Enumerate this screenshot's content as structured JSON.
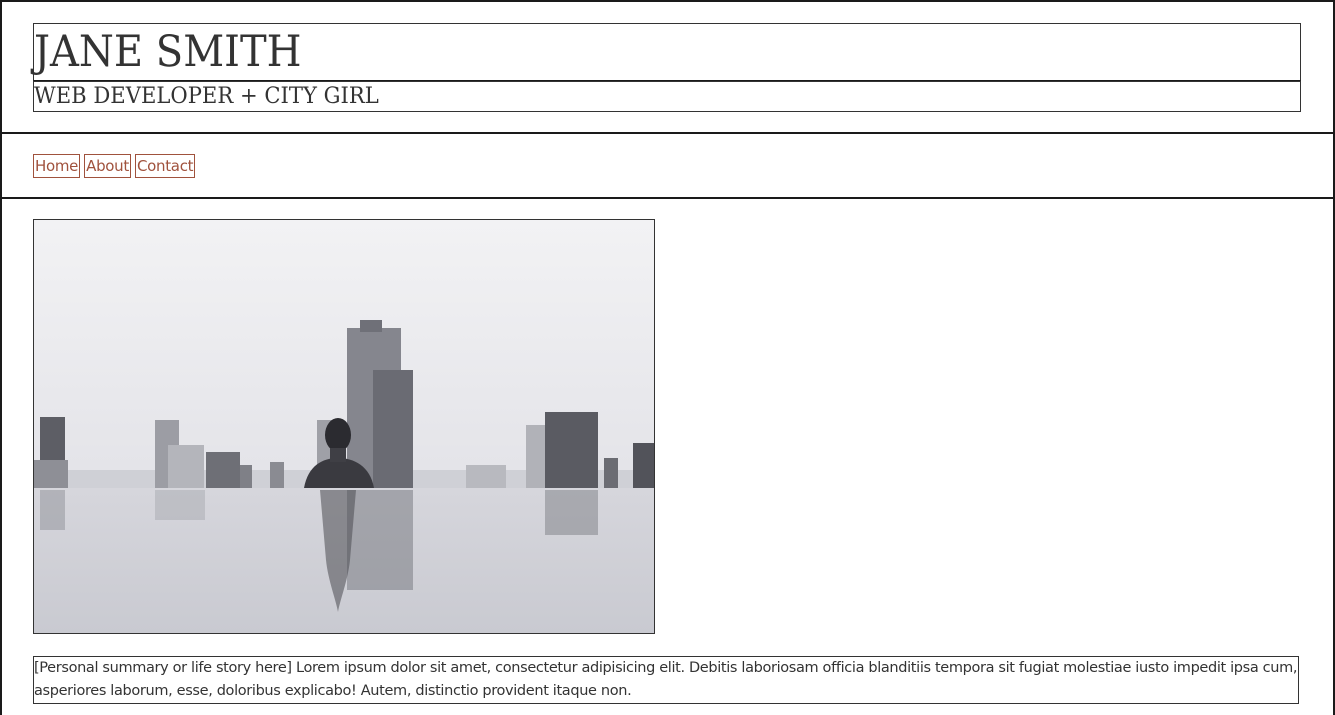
{
  "header": {
    "name": "JANE SMITH",
    "tagline": "WEB DEVELOPER + CITY GIRL"
  },
  "nav": {
    "items": [
      {
        "label": "Home"
      },
      {
        "label": "About"
      },
      {
        "label": "Contact"
      }
    ]
  },
  "main": {
    "hero_image": {
      "icon": "photo-woman-in-rooftop-pool-with-city-skyline",
      "style": "black-and-white"
    },
    "summary": "[Personal summary or life story here] Lorem ipsum dolor sit amet, consectetur adipisicing elit. Debitis laboriosam officia blanditiis tempora sit fugiat molestiae iusto impedit ipsa cum, asperiores laborum, esse, doloribus explicabo! Autem, distinctio provident itaque non."
  },
  "colors": {
    "link": "#a0523d",
    "border": "#1a1a1a",
    "text": "#333333"
  }
}
